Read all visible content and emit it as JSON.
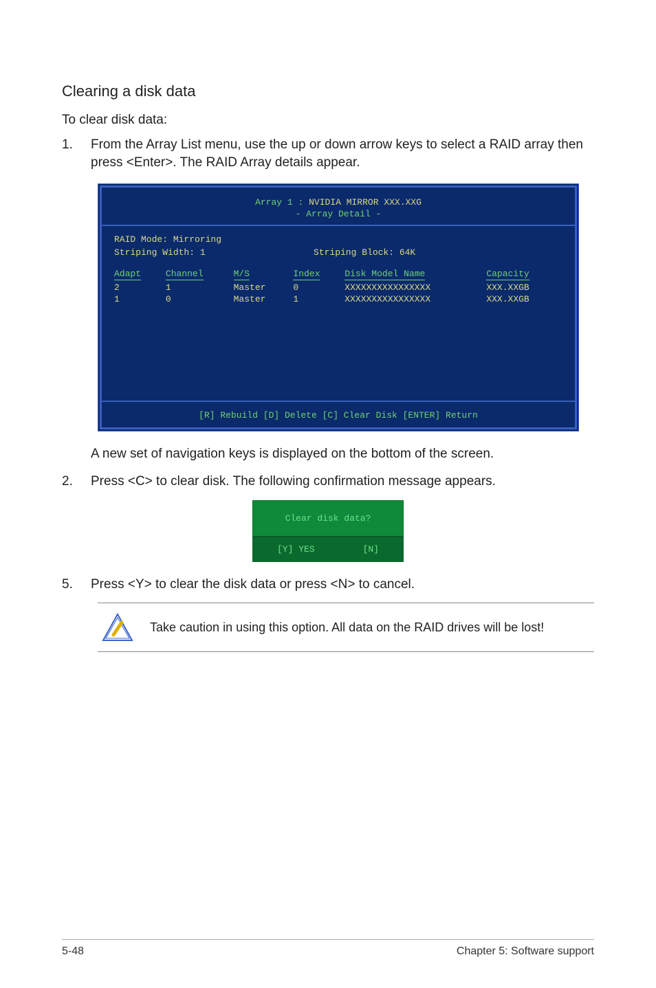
{
  "section_title": "Clearing a disk data",
  "intro": "To clear disk data:",
  "step1": {
    "num": "1.",
    "text": "From the Array List menu, use the up or down arrow keys to select a RAID array then press <Enter>. The RAID Array details appear."
  },
  "bios": {
    "title_prefix": "Array 1 : ",
    "title_main": "NVIDIA MIRROR  XXX.XXG",
    "subtitle": "- Array Detail -",
    "raid_mode_label": "RAID Mode: ",
    "raid_mode_value": "Mirroring",
    "strip_width_label": "Striping Width: ",
    "strip_width_value": "1",
    "strip_block_label": "Striping Block: ",
    "strip_block_value": "64K",
    "headers": {
      "adapt": "Adapt",
      "channel": "Channel",
      "ms": "M/S",
      "index": "Index",
      "model": "Disk Model Name",
      "capacity": "Capacity"
    },
    "rows": [
      {
        "adapt": "2",
        "channel": "1",
        "ms": "Master",
        "index": "0",
        "model": "XXXXXXXXXXXXXXXX",
        "capacity": "XXX.XXGB"
      },
      {
        "adapt": "1",
        "channel": "0",
        "ms": "Master",
        "index": "1",
        "model": "XXXXXXXXXXXXXXXX",
        "capacity": "XXX.XXGB"
      }
    ],
    "footer": "[R] Rebuild  [D] Delete  [C] Clear Disk  [ENTER] Return"
  },
  "step_after": "A new set of  navigation keys is displayed on the bottom of the screen.",
  "step2": {
    "num": "2.",
    "text": "Press <C> to clear disk. The following confirmation message appears."
  },
  "dialog": {
    "question": "Clear disk data?",
    "yes": "[Y] YES",
    "no": "[N]"
  },
  "step5": {
    "num": "5.",
    "text": "Press <Y> to clear the disk data or press <N> to cancel."
  },
  "note": "Take caution in using this option. All data on the RAID drives will be lost!",
  "footer_left": "5-48",
  "footer_right": "Chapter 5: Software support"
}
